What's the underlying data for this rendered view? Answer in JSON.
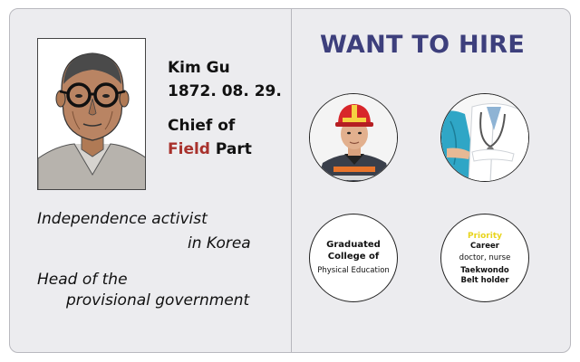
{
  "profile": {
    "name": "Kim Gu",
    "date": "1872. 08. 29.",
    "title_line1": "Chief of",
    "title_field": "Field",
    "title_part": "Part"
  },
  "description": {
    "line1": "Independence activist",
    "line2": "in Korea",
    "line3": "Head of the",
    "line4": "provisional government"
  },
  "hire": {
    "title": "WANT TO HIRE",
    "education_line1": "Graduated",
    "education_line2": "College of",
    "education_line3": "Physical Education",
    "priority_label": "Priority",
    "career_label": "Career",
    "career_value": "doctor, nurse",
    "taekwondo_line1": "Taekwondo",
    "taekwondo_line2": "Belt holder"
  },
  "colors": {
    "hire_title": "#3d3f7c",
    "field_accent": "#a8312c",
    "priority": "#e8d41c"
  }
}
